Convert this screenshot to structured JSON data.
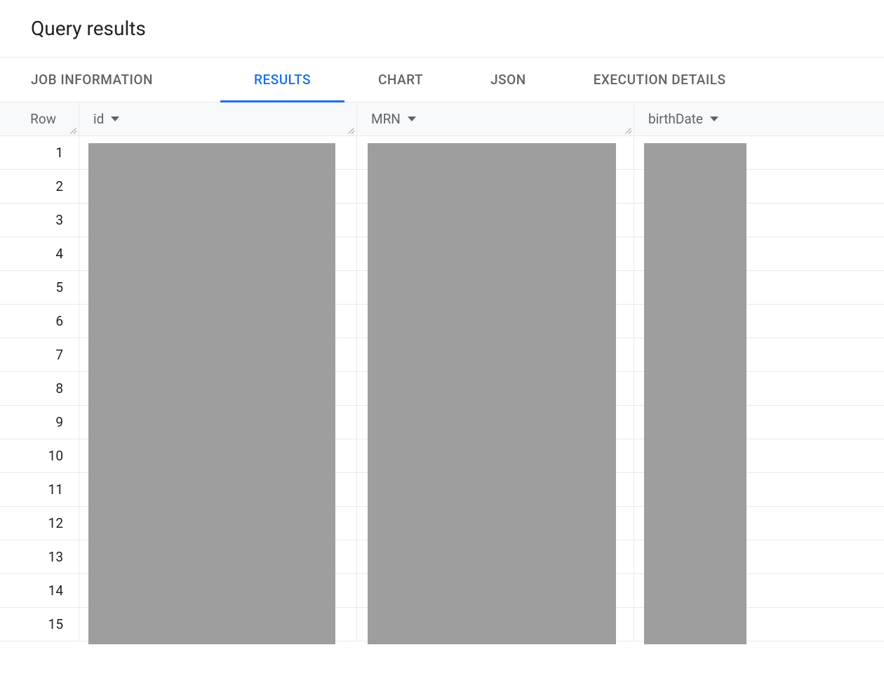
{
  "header": {
    "title": "Query results"
  },
  "tabs": [
    {
      "id": "job-information",
      "label": "JOB INFORMATION",
      "active": false
    },
    {
      "id": "results",
      "label": "RESULTS",
      "active": true
    },
    {
      "id": "chart",
      "label": "CHART",
      "active": false
    },
    {
      "id": "json",
      "label": "JSON",
      "active": false
    },
    {
      "id": "execution-details",
      "label": "EXECUTION DETAILS",
      "active": false
    }
  ],
  "table": {
    "columns": {
      "row": "Row",
      "id": "id",
      "mrn": "MRN",
      "birthDate": "birthDate"
    },
    "rows": [
      {
        "num": "1"
      },
      {
        "num": "2"
      },
      {
        "num": "3"
      },
      {
        "num": "4"
      },
      {
        "num": "5"
      },
      {
        "num": "6"
      },
      {
        "num": "7"
      },
      {
        "num": "8"
      },
      {
        "num": "9"
      },
      {
        "num": "10"
      },
      {
        "num": "11"
      },
      {
        "num": "12"
      },
      {
        "num": "13"
      },
      {
        "num": "14"
      },
      {
        "num": "15"
      }
    ]
  }
}
